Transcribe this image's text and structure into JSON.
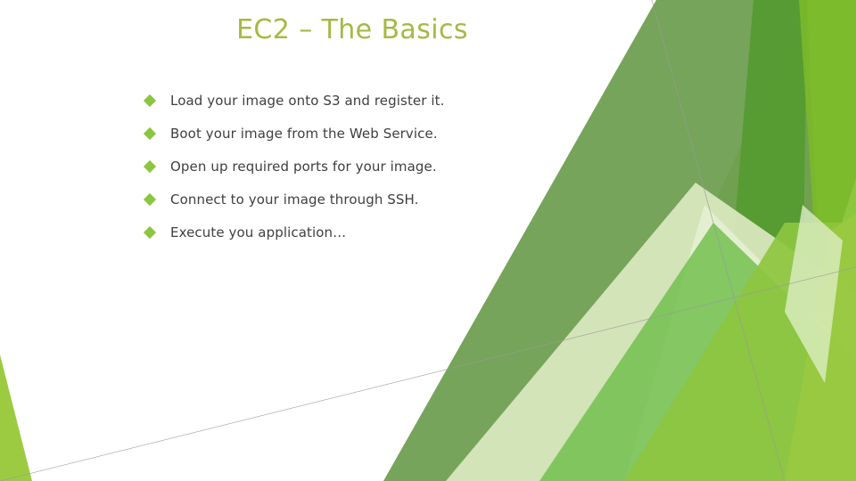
{
  "slide": {
    "title": "EC2 – The Basics",
    "title_color": "#a4ba43",
    "background_color": "#ffffff",
    "body_text_color": "#3f3f3f",
    "bullet_marker_color": "#8cc63f",
    "bullet_marker_icon": "diamond-bullet-icon"
  },
  "bullets": [
    {
      "text": "Load your image onto S3 and register it."
    },
    {
      "text": "Boot your image from the Web Service."
    },
    {
      "text": "Open up required ports for your image."
    },
    {
      "text": "Connect to your image through SSH."
    },
    {
      "text": "Execute you application…"
    }
  ],
  "decoration": {
    "name": "angular-green-facets",
    "colors": {
      "olive_green": "#6f9f51",
      "mid_green": "#70a352",
      "bright_green": "#7ab929",
      "yellow_green": "#8dc63f",
      "light_yellow_green": "#9ccb42",
      "dark_green": "#529a2e",
      "pale_green": "#dbe9c0",
      "very_pale_green": "#e7f0d4",
      "hairline_gray": "#9a9a9a"
    }
  }
}
